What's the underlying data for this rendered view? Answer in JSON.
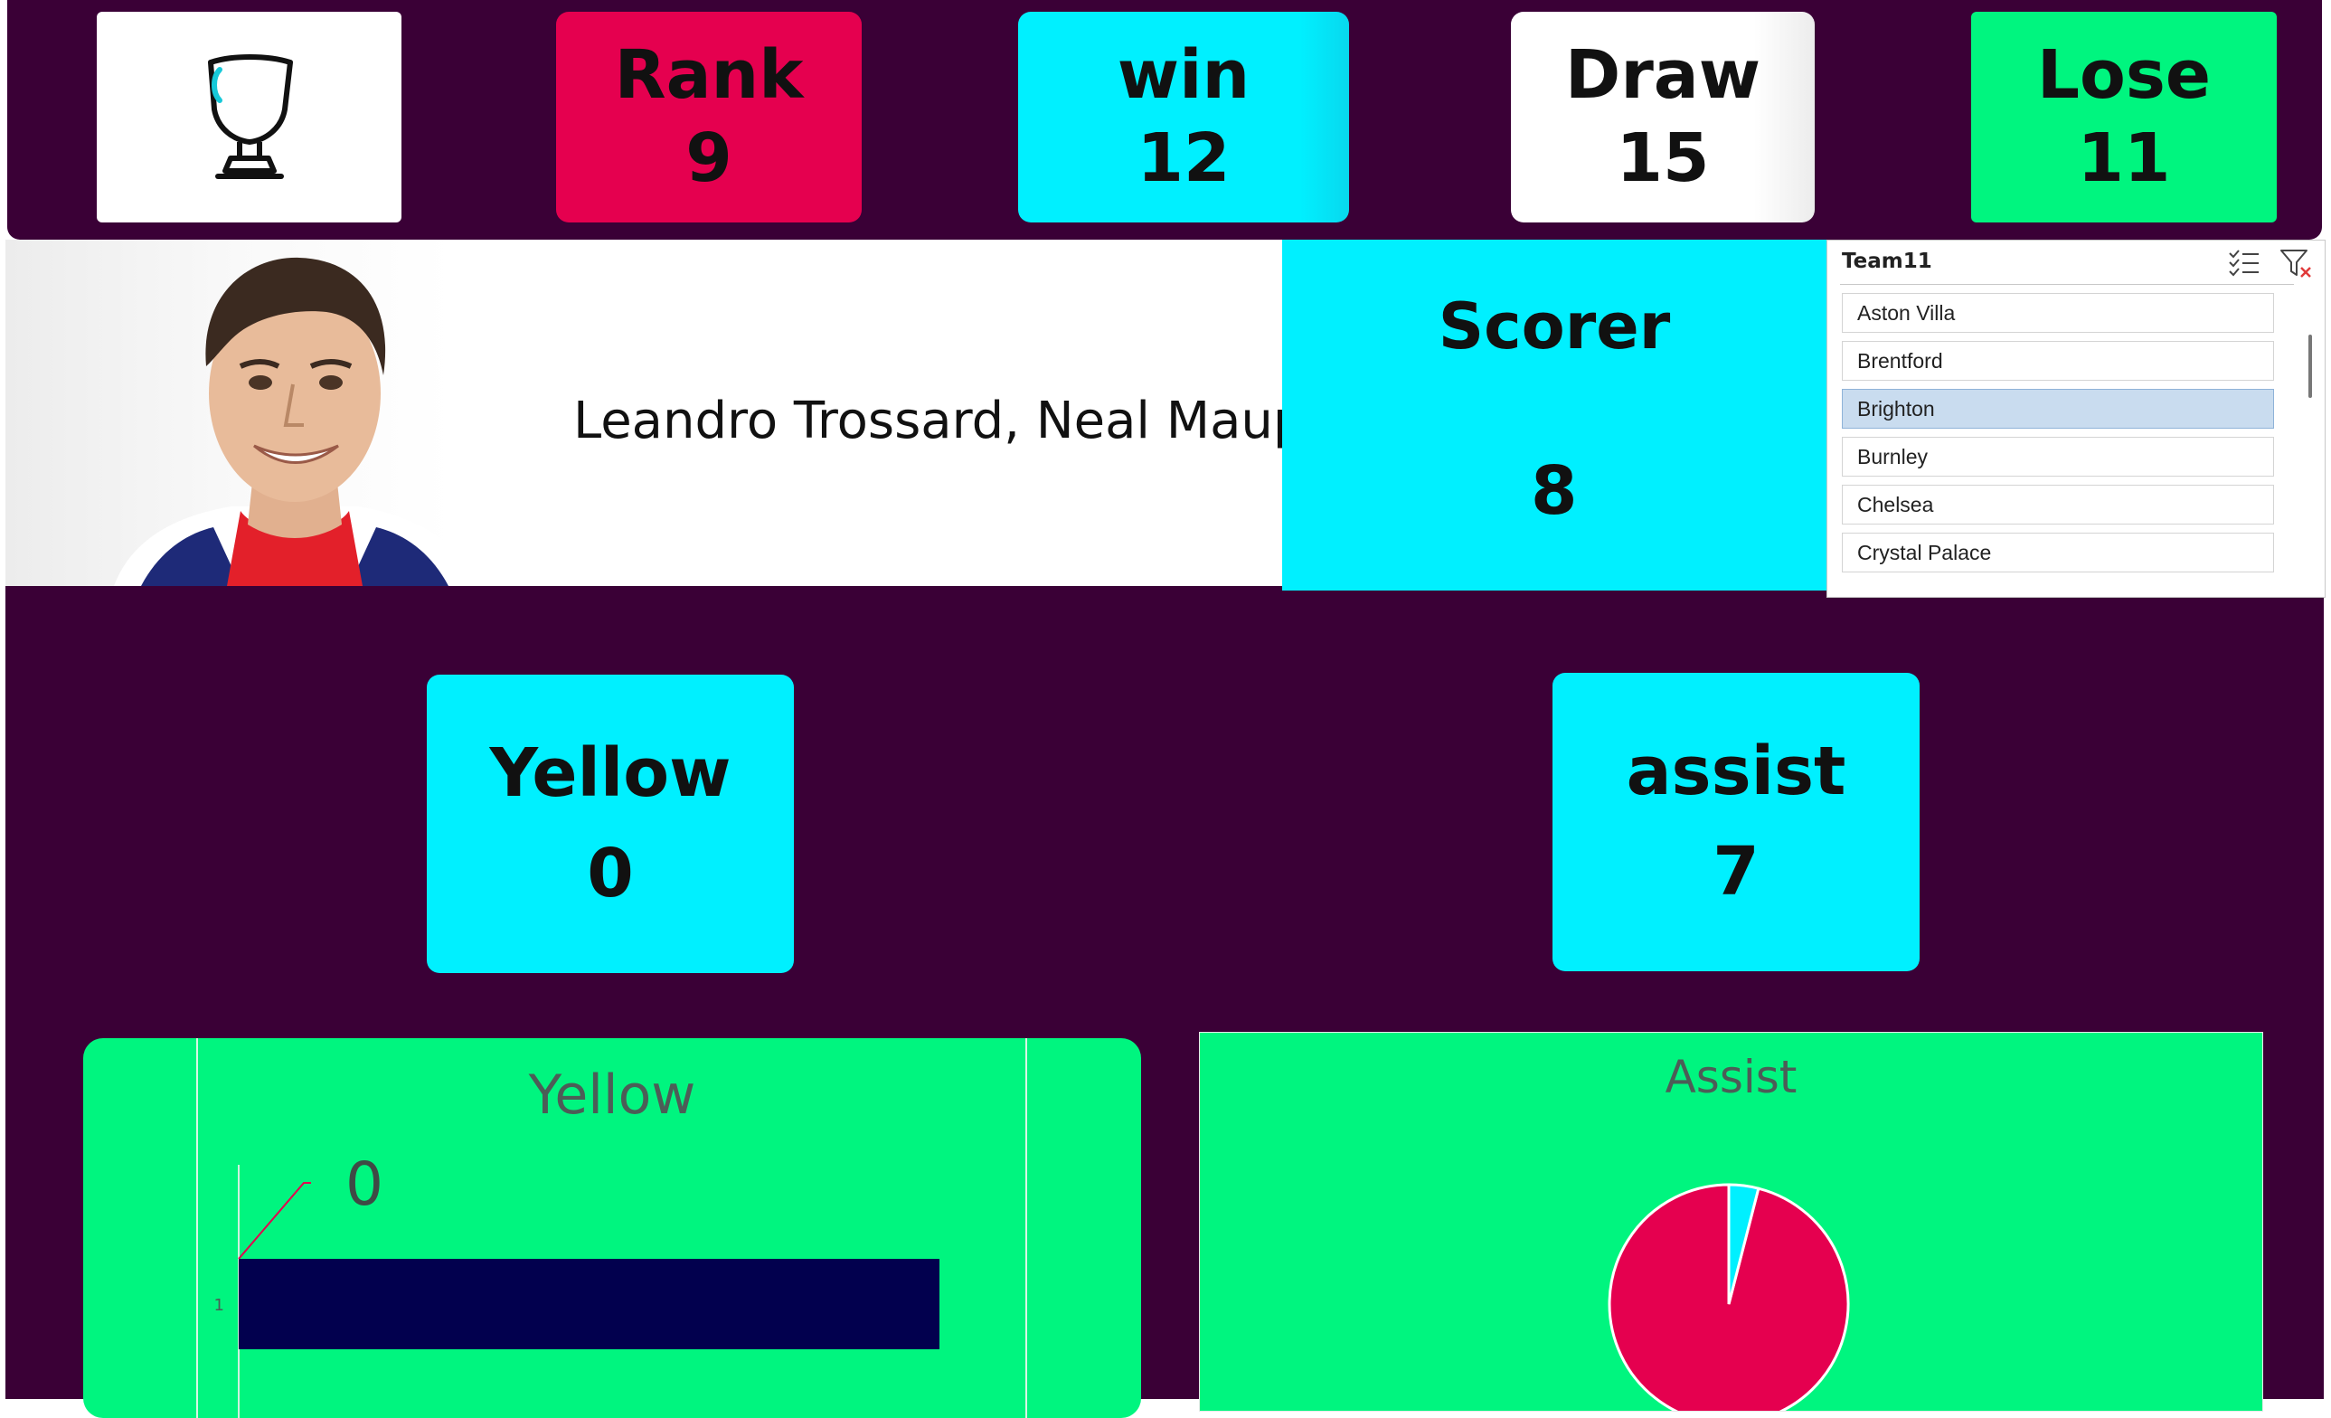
{
  "header": {
    "rank": {
      "label": "Rank",
      "value": "9"
    },
    "win": {
      "label": "win",
      "value": "12"
    },
    "draw": {
      "label": "Draw",
      "value": "15"
    },
    "lose": {
      "label": "Lose",
      "value": "11"
    }
  },
  "player": {
    "names": "Leandro Trossard, Neal Maup"
  },
  "scorer": {
    "label": "Scorer",
    "value": "8"
  },
  "slicer": {
    "title": "Team11",
    "items": [
      "Aston Villa",
      "Brentford",
      "Brighton",
      "Burnley",
      "Chelsea",
      "Crystal Palace"
    ],
    "selected": "Brighton"
  },
  "cards": {
    "yellow": {
      "label": "Yellow",
      "value": "0"
    },
    "assist": {
      "label": "assist",
      "value": "7"
    }
  },
  "colors": {
    "background": "#3a0036",
    "rank_card": "#e5004f",
    "win_card": "#00f0ff",
    "draw_card": "#ffffff",
    "lose_card": "#00f57f",
    "chart_bg": "#00f57f",
    "bar": "#02004e",
    "pie_main": "#e5004f",
    "pie_small": "#00f0ff"
  },
  "chart_data": [
    {
      "type": "bar",
      "orientation": "horizontal",
      "title": "Yellow",
      "categories": [
        "1"
      ],
      "values": [
        0
      ],
      "data_label": "0"
    },
    {
      "type": "pie",
      "title": "Assist",
      "slices": [
        {
          "value": 96
        },
        {
          "value": 4
        }
      ]
    }
  ]
}
